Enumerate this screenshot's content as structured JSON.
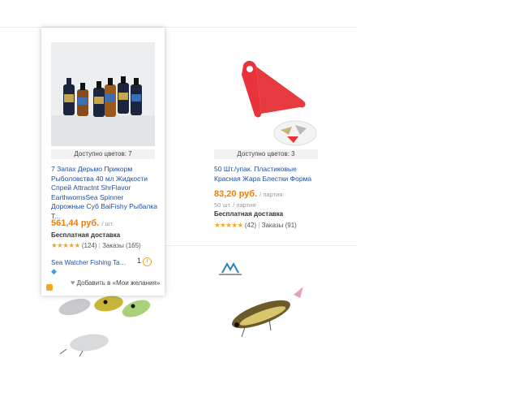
{
  "products": [
    {
      "colors_label": "Доступно цветов: 7",
      "title": "7 Запах Дерьмо Прикорм Рыболовства 40 мл Жидкости Спрей Attractnt ShrFlavor EarthwomsSea Spinner Дорожные Суб BaiFishy Рыбалка Т...",
      "price": "561,44 руб.",
      "price_unit": "/ шт.",
      "shipping": "Бесплатная доставка",
      "reviews": "(124)",
      "orders": "Заказы (165)",
      "store": "Sea Watcher Fishing Tac...",
      "store_count": "1",
      "wishlist": "Добавить в «Мои желания»",
      "image_icon": "bottles-photo"
    },
    {
      "colors_label": "Доступно цветов: 3",
      "title": "50 Шт./упак. Пластиковые Красная Жара Блестки Форма",
      "price": "83,20 руб.",
      "price_unit": "/ партия",
      "lot_info": "50 шт. / партия",
      "shipping": "Бесплатная доставка",
      "reviews": "(42)",
      "orders": "Заказы (91)",
      "image_icon": "red-triangle-lure-photo"
    }
  ],
  "stars": "★★★★★",
  "colors": {
    "accent_price": "#f07c00",
    "link": "#1e4fa3",
    "star": "#f7a51c"
  }
}
